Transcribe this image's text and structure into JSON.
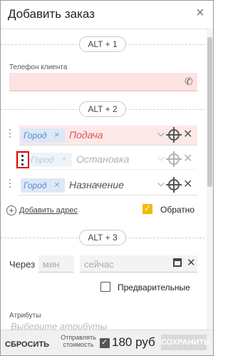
{
  "dialog": {
    "title": "Добавить заказ",
    "close_glyph": "×"
  },
  "sections": {
    "hotkey1": "ALT + 1",
    "hotkey2": "ALT + 2",
    "hotkey3": "ALT + 3"
  },
  "phone": {
    "label": "Телефон клиента",
    "value": "",
    "icon": "phone-icon"
  },
  "addresses": [
    {
      "city": "Город",
      "placeholder": "Подача",
      "state": "error"
    },
    {
      "city": "Город",
      "placeholder": "Остановка",
      "state": "dragging"
    },
    {
      "city": "Город",
      "placeholder": "Назначение",
      "state": "normal"
    }
  ],
  "add_address": {
    "label": "Добавить адрес"
  },
  "reverse": {
    "label": "Обратно",
    "checked": true
  },
  "timing": {
    "via_label": "Через",
    "minutes_placeholder": "мин",
    "time_placeholder": "сейчас"
  },
  "preliminary": {
    "label": "Предварительные",
    "checked": false
  },
  "attributes": {
    "label": "Атрибуты",
    "placeholder": "Выберите атрибуты"
  },
  "footer": {
    "reset_label": "СБРОСИТЬ",
    "send_cost_label": "Отправлять стоимость",
    "send_cost_checked": true,
    "price": "180 руб",
    "save_label": "СОХРАНИТЬ"
  },
  "colors": {
    "error_bg": "#fde2e2",
    "chip_bg": "#dce8f7",
    "accent_orange": "#f5b800",
    "highlight_red": "#e00000"
  }
}
